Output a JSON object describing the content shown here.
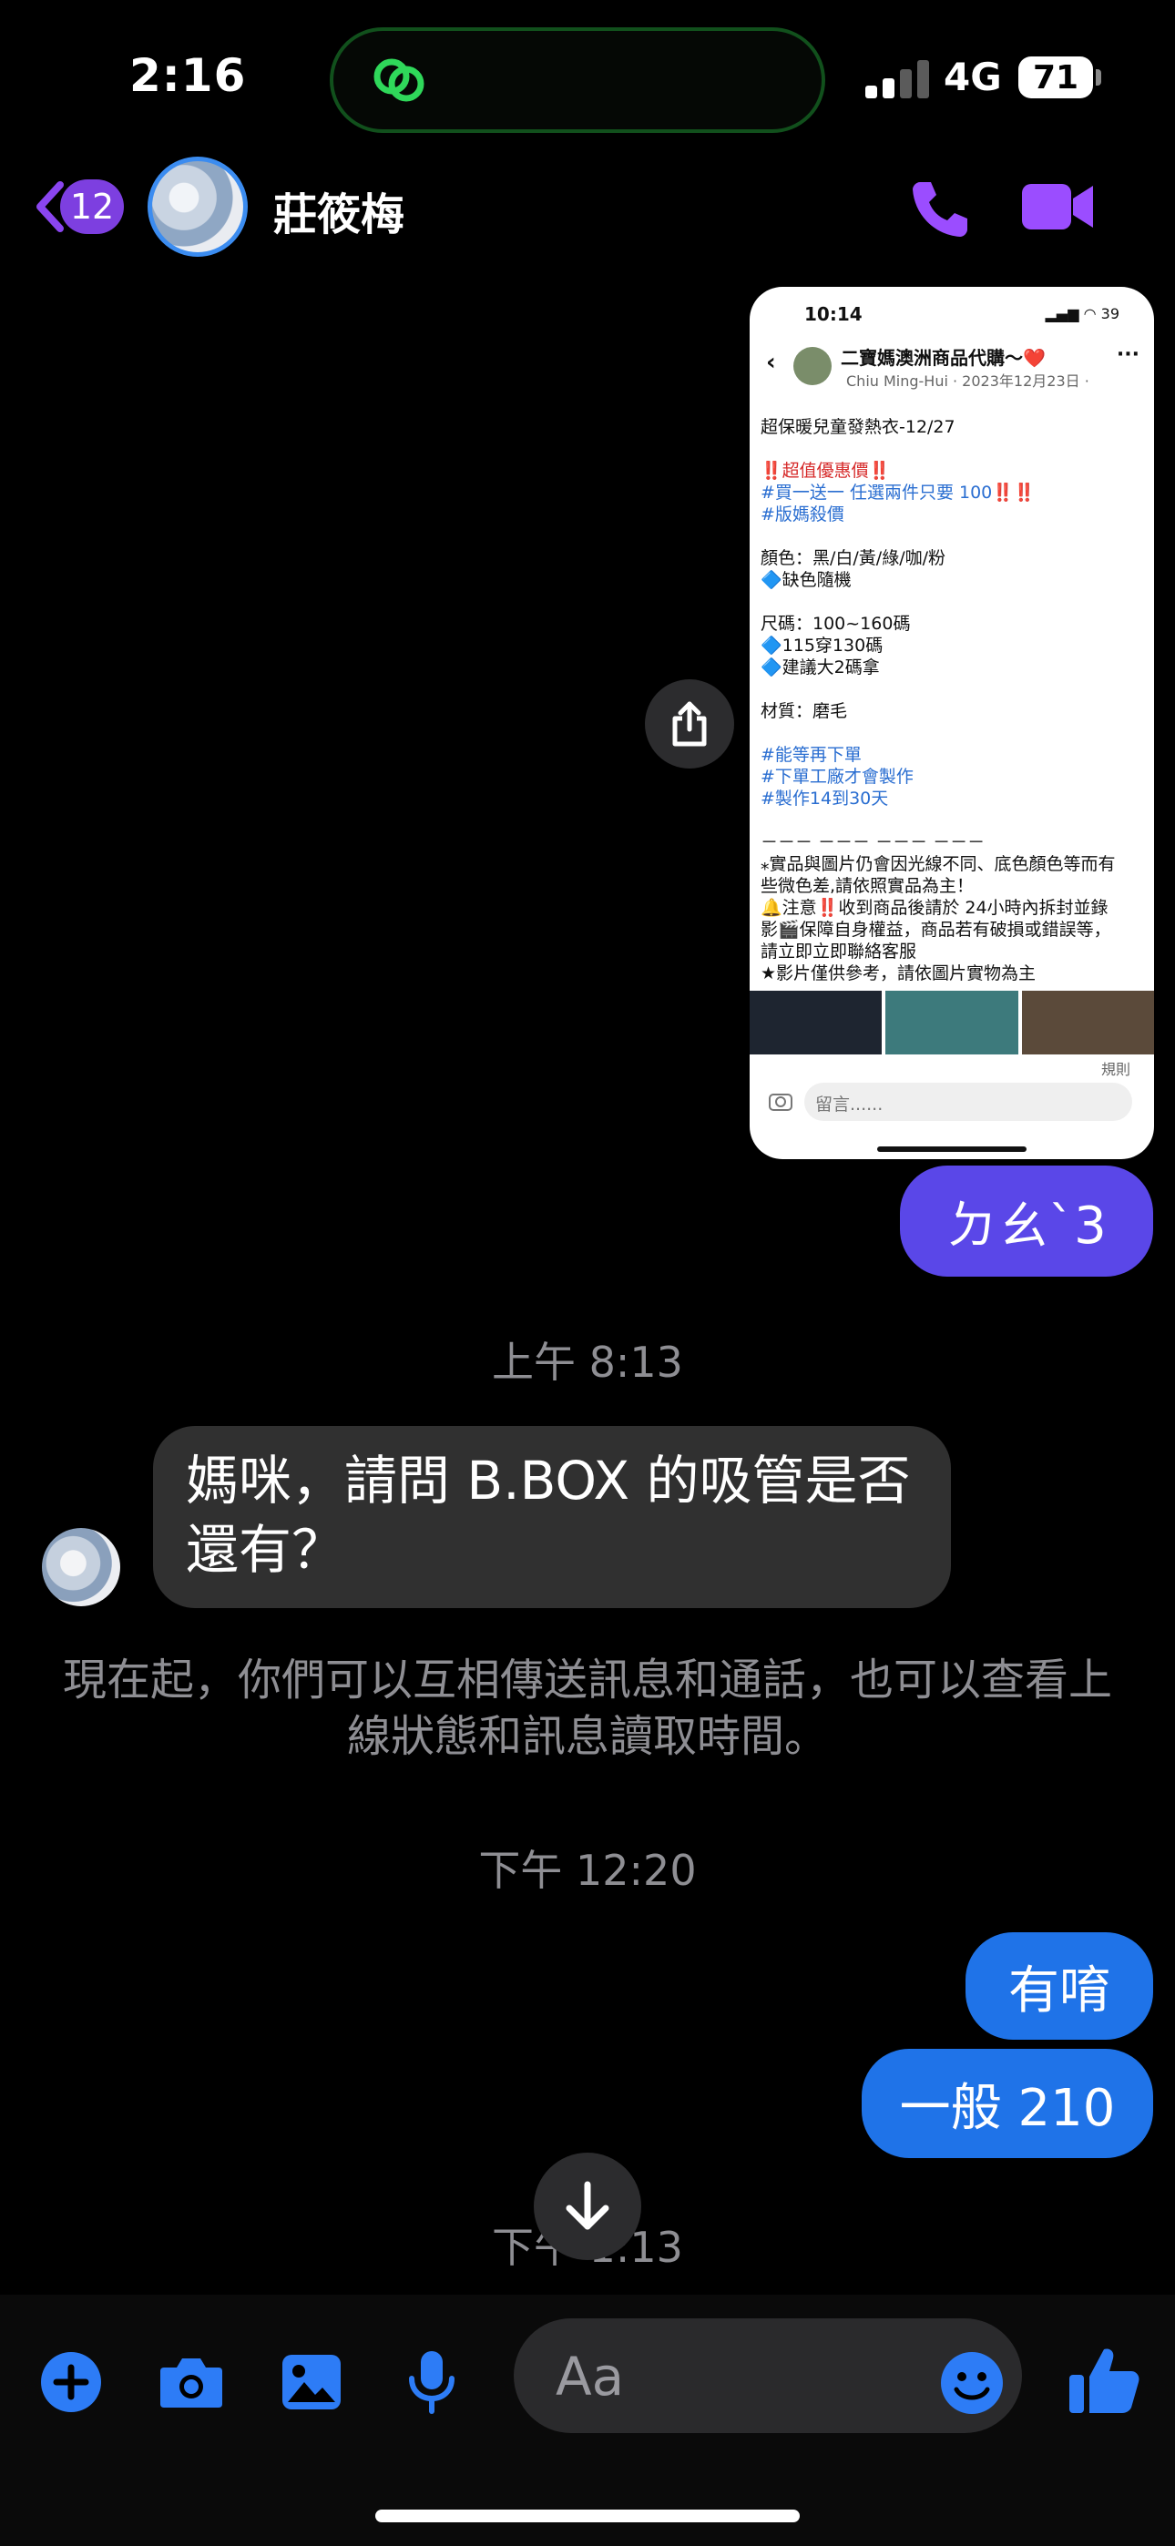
{
  "status_bar": {
    "time": "2:16",
    "network": "4G",
    "battery": "71"
  },
  "header": {
    "back_badge": "12",
    "contact_name": "莊筱梅"
  },
  "shared_post": {
    "status_time": "10:14",
    "status_battery": "39",
    "group_title": "二寶媽澳洲商品代購～❤️",
    "author_line": "Chiu Ming-Hui · 2023年12月23日 ·",
    "lines": [
      "超保暖兒童發熱衣-12/27",
      "",
      "‼️超值優惠價‼️",
      "#買一送一 任選兩件只要 100‼️‼️",
      "#版媽殺價",
      "",
      " 顏色：黑/白/黃/綠/咖/粉",
      "🔷缺色隨機",
      "",
      "尺碼：100~160碼",
      "🔷115穿130碼",
      "🔷建議大2碼拿",
      "",
      "材質：磨毛",
      "",
      "#能等再下單",
      "#下單工廠才會製作",
      "#製作14到30天",
      "",
      "－－－ －－－ －－－ －－－",
      "⁎實品與圖片仍會因光線不同、底色顏色等而有",
      "些微色差,請依照實品為主！",
      "🔔注意‼️收到商品後請於 24小時內拆封並錄",
      "影🎬保障自身權益，商品若有破損或錯誤等，",
      "請立即立即聯絡客服",
      "★影片僅供參考，請依圖片實物為主"
    ],
    "rules_label": "規則",
    "comment_placeholder": "留言......"
  },
  "messages": {
    "outgoing_1": "ㄉㄠˋ3",
    "timestamp_1": "上午 8:13",
    "incoming_1": "媽咪，請問 B.BOX 的吸管是否還有？",
    "system_note": "現在起，你們可以互相傳送訊息和通話，也可以查看上線狀態和訊息讀取時間。",
    "timestamp_2": "下午 12:20",
    "outgoing_2": "有唷",
    "outgoing_3": "一般 210",
    "timestamp_3": "下午 1:13"
  },
  "composer": {
    "placeholder": "Aa"
  },
  "colors": {
    "accent_purple": "#7d3fe0",
    "bubble_purple": "#5a47e8",
    "bubble_blue": "#1f73e8",
    "icon_blue": "#2d7cf6"
  },
  "icons": [
    "island-link-icon",
    "back-chevron-icon",
    "phone-icon",
    "video-call-icon",
    "share-icon",
    "scroll-down-arrow-icon",
    "plus-icon",
    "camera-icon",
    "gallery-icon",
    "microphone-icon",
    "emoji-icon",
    "thumbs-up-icon"
  ]
}
